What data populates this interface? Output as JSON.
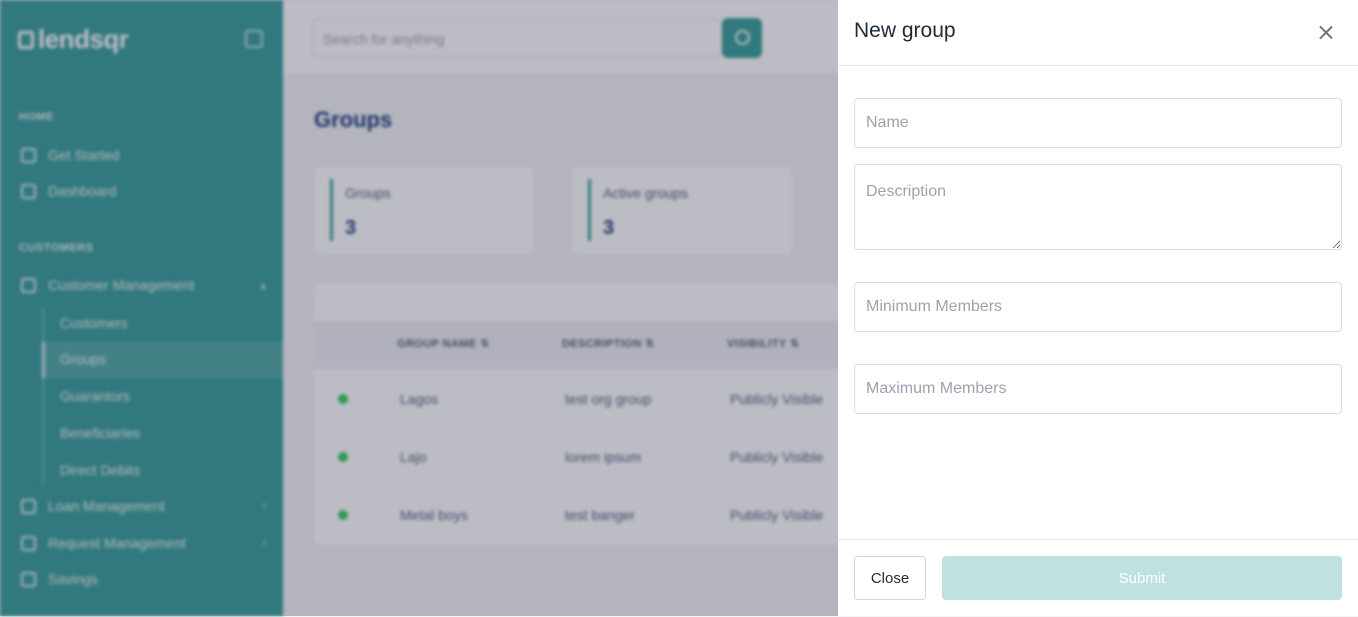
{
  "sidebar": {
    "logo_text": "lendsqr",
    "sections": [
      "HOME",
      "CUSTOMERS"
    ],
    "home_items": [
      "Get Started",
      "Dashboard"
    ],
    "customer_management": {
      "label": "Customer Management",
      "subitems": [
        "Customers",
        "Groups",
        "Guarantors",
        "Beneficiaries",
        "Direct Debits"
      ]
    },
    "other_items": [
      "Loan Management",
      "Request Management",
      "Savings"
    ]
  },
  "topbar": {
    "search_placeholder": "Search for anything"
  },
  "page": {
    "title": "Groups",
    "stats": [
      {
        "label": "Groups",
        "value": "3"
      },
      {
        "label": "Active groups",
        "value": "3"
      }
    ],
    "table": {
      "headers": [
        "GROUP NAME",
        "DESCRIPTION",
        "VISIBILITY"
      ],
      "rows": [
        {
          "name": "Lagos",
          "description": "test org group",
          "visibility": "Publicly Visible"
        },
        {
          "name": "Lajo",
          "description": "lorem ipsum",
          "visibility": "Publicly Visible"
        },
        {
          "name": "Metal boys",
          "description": "test banger",
          "visibility": "Publicly Visible"
        }
      ]
    }
  },
  "drawer": {
    "title": "New group",
    "fields": {
      "name_placeholder": "Name",
      "description_placeholder": "Description",
      "min_placeholder": "Minimum Members",
      "max_placeholder": "Maximum Members"
    },
    "close_label": "Close",
    "submit_label": "Submit"
  },
  "colors": {
    "brand": "#39a09b",
    "submit_disabled": "#bfe2e0",
    "status_active": "#39cd62"
  }
}
